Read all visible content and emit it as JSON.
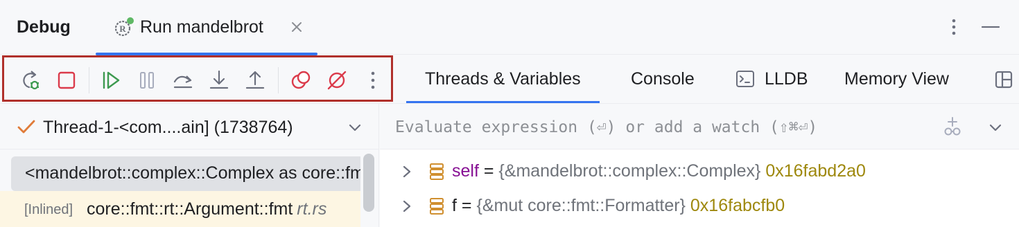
{
  "header": {
    "title": "Debug",
    "run_tab_label": "Run mandelbrot"
  },
  "toolbar": {
    "buttons": [
      "rerun-debug",
      "stop",
      "resume",
      "pause",
      "step-over",
      "step-into",
      "step-out",
      "view-breakpoints",
      "mute-breakpoints",
      "more"
    ]
  },
  "tabs": {
    "threads_variables": "Threads & Variables",
    "console": "Console",
    "lldb": "LLDB",
    "memory_view": "Memory View"
  },
  "thread_selector": {
    "label": "Thread-1-<com....ain] (1738764)"
  },
  "frames": [
    {
      "text": "<mandelbrot::complex::Complex as core::fmt::Debug>::fmt"
    },
    {
      "tag": "[Inlined]",
      "function": "core::fmt::rt::Argument::fmt",
      "file": "rt.rs"
    }
  ],
  "evaluate": {
    "placeholder": "Evaluate expression (⏎) or add a watch (⇧⌘⏎)"
  },
  "variables": [
    {
      "name": "self",
      "eq": "=",
      "type": "{&mandelbrot::complex::Complex}",
      "value": "0x16fabd2a0"
    },
    {
      "name": "f",
      "eq": "=",
      "type": "{&mut core::fmt::Formatter}",
      "value": "0x16fabcfb0"
    }
  ],
  "colors": {
    "accent": "#3574f0",
    "stop": "#db3b4b",
    "resume": "#3d9a50",
    "highlight_box": "#b0302b",
    "value": "#9e880d",
    "var_name": "#871094"
  }
}
